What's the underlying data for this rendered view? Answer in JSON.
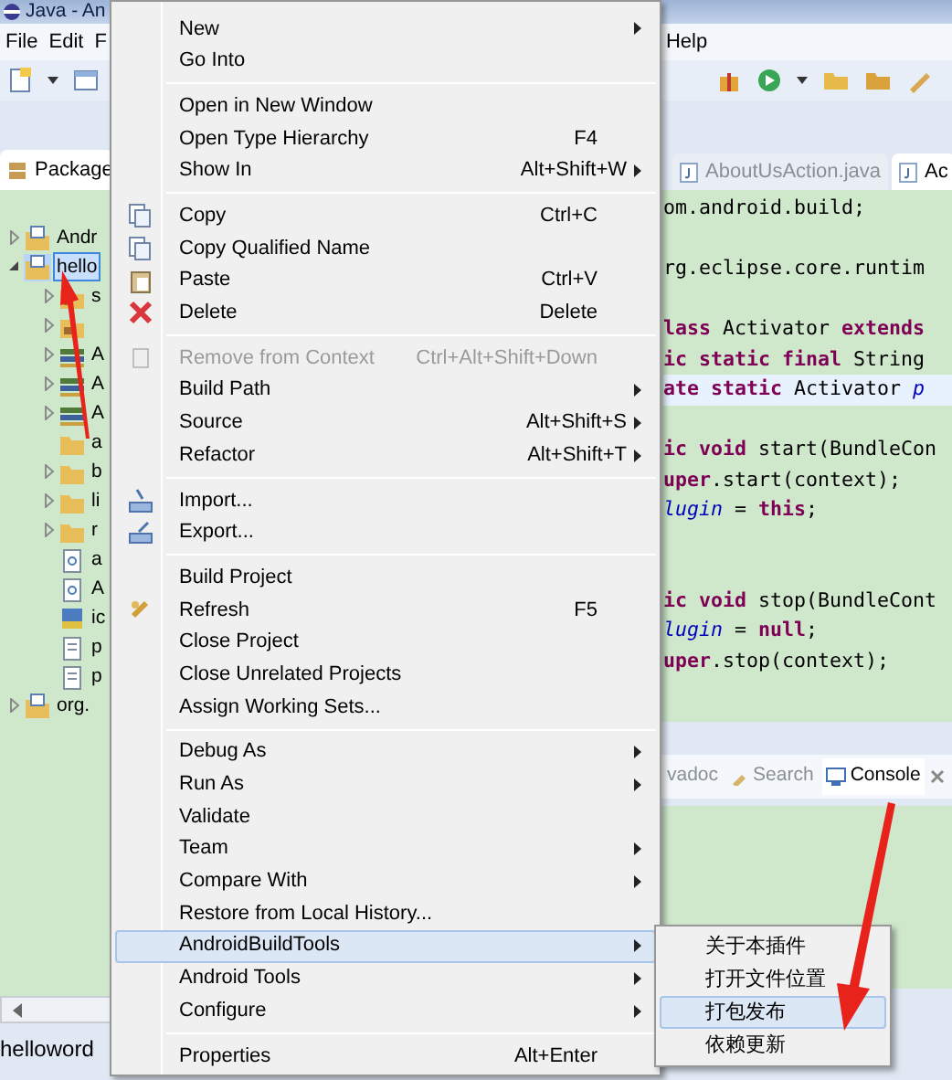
{
  "window": {
    "title": "Java - An"
  },
  "menu_bar": [
    "File",
    "Edit",
    "F",
    "Help"
  ],
  "package_explorer": {
    "tab": "Package",
    "tree": [
      {
        "label": "Andr",
        "kind": "project",
        "expanded": false,
        "selected": false
      },
      {
        "label": "hello",
        "kind": "project",
        "expanded": true,
        "selected": true,
        "children": [
          {
            "label": "s",
            "kind": "source",
            "expanded": false,
            "selected": false
          },
          {
            "kind": "source",
            "expanded": false,
            "selected": false
          },
          {
            "label": "A",
            "kind": "library",
            "expanded": false,
            "selected": false
          },
          {
            "label": "A",
            "kind": "library",
            "expanded": false,
            "selected": false
          },
          {
            "label": "A",
            "kind": "library",
            "expanded": false,
            "selected": false
          },
          {
            "label": "a",
            "kind": "folder",
            "selected": false
          },
          {
            "label": "b",
            "kind": "folder",
            "expanded": false,
            "selected": false
          },
          {
            "label": "li",
            "kind": "folder",
            "expanded": false,
            "selected": false
          },
          {
            "label": "r",
            "kind": "folder",
            "expanded": false,
            "selected": false
          },
          {
            "label": "a",
            "kind": "file",
            "selected": false
          },
          {
            "label": "A",
            "kind": "file",
            "selected": false
          },
          {
            "label": "ic",
            "kind": "image",
            "selected": false
          },
          {
            "label": "p",
            "kind": "text",
            "selected": false
          },
          {
            "label": "p",
            "kind": "text",
            "selected": false
          }
        ]
      },
      {
        "label": "org.",
        "kind": "project",
        "expanded": false,
        "selected": false
      }
    ]
  },
  "editor": {
    "tabs": [
      {
        "label": "AboutUsAction.java",
        "selected": false
      },
      {
        "label": "Ac",
        "selected": true
      }
    ],
    "lines": [
      {
        "kind": "code",
        "segments": [
          {
            "kind": "plain",
            "text": "om.android.build;"
          }
        ]
      },
      {
        "kind": "blank"
      },
      {
        "kind": "code",
        "segments": [
          {
            "kind": "plain",
            "text": "rg.eclipse.core.runtim"
          }
        ]
      },
      {
        "kind": "blank"
      },
      {
        "kind": "code",
        "segments": [
          {
            "kind": "keyword",
            "text": "lass"
          },
          {
            "kind": "plain",
            "text": " Activator "
          },
          {
            "kind": "keyword",
            "text": "extends"
          }
        ]
      },
      {
        "kind": "code",
        "segments": [
          {
            "kind": "keyword",
            "text": "ic static final"
          },
          {
            "kind": "plain",
            "text": " String"
          }
        ]
      },
      {
        "kind": "current",
        "segments": [
          {
            "kind": "keyword",
            "text": "ate static"
          },
          {
            "kind": "plain",
            "text": " Activator "
          },
          {
            "kind": "field",
            "text": "p"
          }
        ]
      },
      {
        "kind": "blank"
      },
      {
        "kind": "code",
        "segments": [
          {
            "kind": "keyword",
            "text": "ic void"
          },
          {
            "kind": "plain",
            "text": " start(BundleCon"
          }
        ]
      },
      {
        "kind": "code",
        "segments": [
          {
            "kind": "keyword",
            "text": "uper"
          },
          {
            "kind": "plain",
            "text": ".start(context);"
          }
        ]
      },
      {
        "kind": "code",
        "segments": [
          {
            "kind": "field",
            "text": "lugin"
          },
          {
            "kind": "plain",
            "text": " = "
          },
          {
            "kind": "keyword",
            "text": "this"
          },
          {
            "kind": "plain",
            "text": ";"
          }
        ]
      },
      {
        "kind": "blank"
      },
      {
        "kind": "blank"
      },
      {
        "kind": "code",
        "segments": [
          {
            "kind": "keyword",
            "text": "ic void"
          },
          {
            "kind": "plain",
            "text": " stop(BundleCont"
          }
        ]
      },
      {
        "kind": "code",
        "segments": [
          {
            "kind": "field",
            "text": "lugin"
          },
          {
            "kind": "plain",
            "text": " = "
          },
          {
            "kind": "keyword",
            "text": "null"
          },
          {
            "kind": "plain",
            "text": ";"
          }
        ]
      },
      {
        "kind": "code",
        "segments": [
          {
            "kind": "keyword",
            "text": "uper"
          },
          {
            "kind": "plain",
            "text": ".stop(context);"
          }
        ]
      }
    ]
  },
  "bottom_panel": {
    "tabs": [
      {
        "label": "vadoc",
        "kind": "plain",
        "selected": false
      },
      {
        "label": "Search",
        "kind": "search",
        "selected": false
      },
      {
        "label": "Console",
        "kind": "console",
        "selected": true
      }
    ]
  },
  "status_bar": {
    "text": "helloword"
  },
  "context_menu": {
    "groups": [
      [
        {
          "label": "New",
          "kind": "plain",
          "submenu": true,
          "disabled": false,
          "selected": false
        },
        {
          "label": "Go Into",
          "kind": "plain",
          "submenu": false,
          "disabled": false,
          "selected": false
        }
      ],
      [
        {
          "label": "Open in New Window",
          "kind": "plain",
          "submenu": false,
          "disabled": false,
          "selected": false
        },
        {
          "label": "Open Type Hierarchy",
          "kind": "plain",
          "shortcut": "F4",
          "submenu": false,
          "disabled": false,
          "selected": false
        },
        {
          "label": "Show In",
          "kind": "plain",
          "shortcut": "Alt+Shift+W",
          "submenu": true,
          "disabled": false,
          "selected": false
        }
      ],
      [
        {
          "label": "Copy",
          "kind": "copy",
          "shortcut": "Ctrl+C",
          "submenu": false,
          "disabled": false,
          "selected": false
        },
        {
          "label": "Copy Qualified Name",
          "kind": "copy",
          "submenu": false,
          "disabled": false,
          "selected": false
        },
        {
          "label": "Paste",
          "kind": "paste",
          "shortcut": "Ctrl+V",
          "submenu": false,
          "disabled": false,
          "selected": false
        },
        {
          "label": "Delete",
          "kind": "delete",
          "shortcut": "Delete",
          "submenu": false,
          "disabled": false,
          "selected": false
        }
      ],
      [
        {
          "label": "Remove from Context",
          "kind": "remove",
          "shortcut": "Ctrl+Alt+Shift+Down",
          "submenu": false,
          "disabled": true,
          "selected": false
        },
        {
          "label": "Build Path",
          "kind": "plain",
          "submenu": true,
          "disabled": false,
          "selected": false
        },
        {
          "label": "Source",
          "kind": "plain",
          "shortcut": "Alt+Shift+S",
          "submenu": true,
          "disabled": false,
          "selected": false
        },
        {
          "label": "Refactor",
          "kind": "plain",
          "shortcut": "Alt+Shift+T",
          "submenu": true,
          "disabled": false,
          "selected": false
        }
      ],
      [
        {
          "label": "Import...",
          "kind": "import",
          "submenu": false,
          "disabled": false,
          "selected": false
        },
        {
          "label": "Export...",
          "kind": "export",
          "submenu": false,
          "disabled": false,
          "selected": false
        }
      ],
      [
        {
          "label": "Build Project",
          "kind": "plain",
          "submenu": false,
          "disabled": false,
          "selected": false
        },
        {
          "label": "Refresh",
          "kind": "refresh",
          "shortcut": "F5",
          "submenu": false,
          "disabled": false,
          "selected": false
        },
        {
          "label": "Close Project",
          "kind": "plain",
          "submenu": false,
          "disabled": false,
          "selected": false
        },
        {
          "label": "Close Unrelated Projects",
          "kind": "plain",
          "submenu": false,
          "disabled": false,
          "selected": false
        },
        {
          "label": "Assign Working Sets...",
          "kind": "plain",
          "submenu": false,
          "disabled": false,
          "selected": false
        }
      ],
      [
        {
          "label": "Debug As",
          "kind": "plain",
          "submenu": true,
          "disabled": false,
          "selected": false
        },
        {
          "label": "Run As",
          "kind": "plain",
          "submenu": true,
          "disabled": false,
          "selected": false
        },
        {
          "label": "Validate",
          "kind": "plain",
          "submenu": false,
          "disabled": false,
          "selected": false
        },
        {
          "label": "Team",
          "kind": "plain",
          "submenu": true,
          "disabled": false,
          "selected": false
        },
        {
          "label": "Compare With",
          "kind": "plain",
          "submenu": true,
          "disabled": false,
          "selected": false
        },
        {
          "label": "Restore from Local History...",
          "kind": "plain",
          "submenu": false,
          "disabled": false,
          "selected": false
        },
        {
          "label": "AndroidBuildTools",
          "kind": "plain",
          "submenu": true,
          "disabled": false,
          "selected": true
        },
        {
          "label": "Android Tools",
          "kind": "plain",
          "submenu": true,
          "disabled": false,
          "selected": false
        },
        {
          "label": "Configure",
          "kind": "plain",
          "submenu": true,
          "disabled": false,
          "selected": false
        }
      ],
      [
        {
          "label": "Properties",
          "kind": "plain",
          "shortcut": "Alt+Enter",
          "submenu": false,
          "disabled": false,
          "selected": false
        }
      ]
    ]
  },
  "submenu": {
    "items": [
      {
        "label": "关于本插件",
        "selected": false
      },
      {
        "label": "打开文件位置",
        "selected": false
      },
      {
        "label": "打包发布",
        "selected": true
      },
      {
        "label": "依赖更新",
        "selected": false
      }
    ]
  }
}
